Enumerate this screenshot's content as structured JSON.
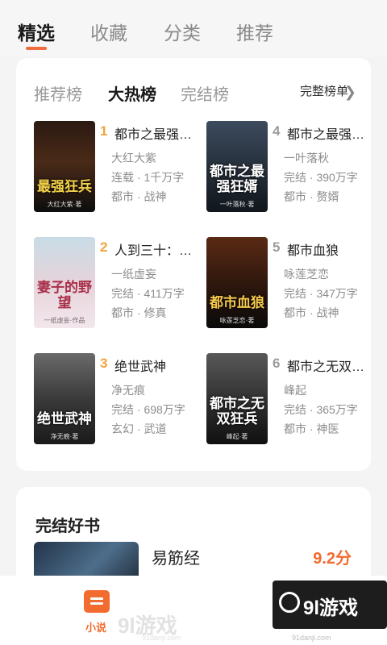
{
  "top_tabs": [
    "精选",
    "收藏",
    "分类",
    "推荐"
  ],
  "rank": {
    "tabs": [
      "推荐榜",
      "大热榜",
      "完结榜"
    ],
    "full_list": "完整榜单",
    "books": [
      {
        "num": "1",
        "title": "都市之最强…",
        "author": "大红大紫",
        "stat": "连载 · 1千万字",
        "tags": "都市 · 战神",
        "cover_title": "最强狂兵",
        "cover_author": "大红大紫·著"
      },
      {
        "num": "4",
        "title": "都市之最强…",
        "author": "一叶落秋",
        "stat": "完结 · 390万字",
        "tags": "都市 · 赘婿",
        "cover_title": "都市之最强狂婿",
        "cover_author": "一叶落秋·著"
      },
      {
        "num": "2",
        "title": "人到三十：…",
        "author": "一纸虚妄",
        "stat": "完结 · 411万字",
        "tags": "都市 · 修真",
        "cover_title": "妻子的野望",
        "cover_author": "一纸虚妄·作品"
      },
      {
        "num": "5",
        "title": "都市血狼",
        "author": "咏莲芝恋",
        "stat": "完结 · 347万字",
        "tags": "都市 · 战神",
        "cover_title": "都市血狼",
        "cover_author": "咏莲芝恋·著"
      },
      {
        "num": "3",
        "title": "绝世武神",
        "author": "净无痕",
        "stat": "完结 · 698万字",
        "tags": "玄幻 · 武道",
        "cover_title": "绝世武神",
        "cover_author": "净无痕·著"
      },
      {
        "num": "6",
        "title": "都市之无双…",
        "author": "峰起",
        "stat": "完结 · 365万字",
        "tags": "都市 · 神医",
        "cover_title": "都市之无双狂兵",
        "cover_author": "峰起·著"
      }
    ]
  },
  "finished": {
    "title": "完结好书",
    "book_name": "易筋经",
    "score": "9.2分"
  },
  "bottom_nav": {
    "active_label": "小说"
  },
  "watermarks": {
    "left_text": "9l游戏",
    "left_url": "91danji.com",
    "right_text": "9l游戏",
    "right_url": "91danji.com"
  },
  "colors": {
    "accent": "#f26b2f",
    "rank_num_top3": "#f3a33b",
    "rank_num_rest": "#9c9c9c"
  }
}
